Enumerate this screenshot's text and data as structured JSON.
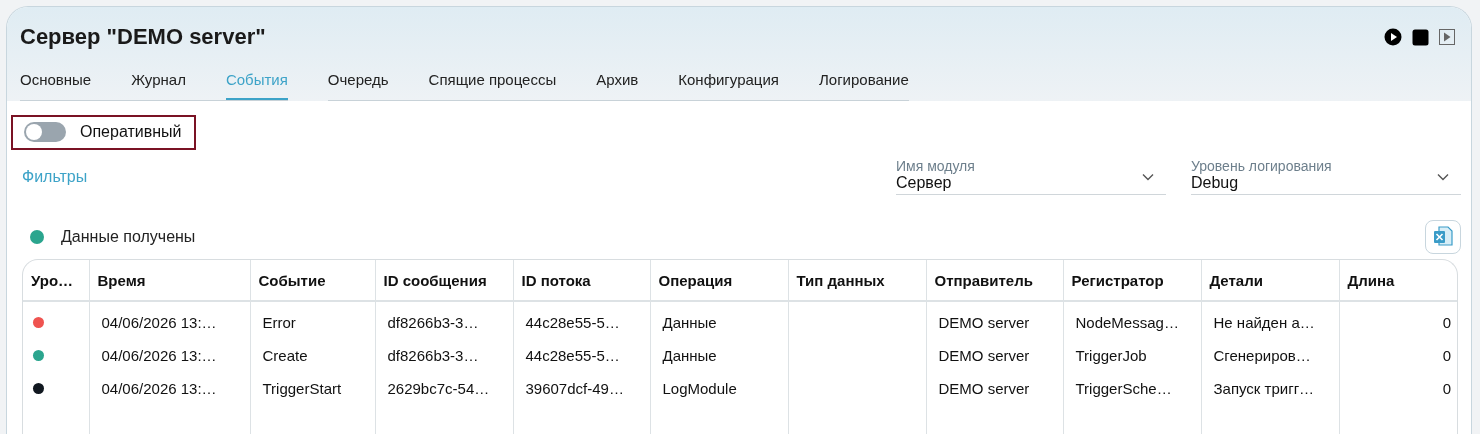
{
  "window": {
    "title": "Сервер \"DEMO server\""
  },
  "tabs": [
    {
      "label": "Основные",
      "selected": false
    },
    {
      "label": "Журнал",
      "selected": false
    },
    {
      "label": "События",
      "selected": true
    },
    {
      "label": "Очередь",
      "selected": false
    },
    {
      "label": "Спящие процессы",
      "selected": false
    },
    {
      "label": "Архив",
      "selected": false
    },
    {
      "label": "Конфигурация",
      "selected": false
    },
    {
      "label": "Логирование",
      "selected": false
    }
  ],
  "live_toggle": {
    "label": "Оперативный",
    "on": false
  },
  "filters_link": "Фильтры",
  "selects": [
    {
      "label": "Имя модуля",
      "value": "Сервер"
    },
    {
      "label": "Уровень логирования",
      "value": "Debug"
    }
  ],
  "status": {
    "text": "Данные получены",
    "color": "#2ba58e"
  },
  "table": {
    "columns": [
      "Уро…",
      "Время",
      "Событие",
      "ID сообщения",
      "ID потока",
      "Операция",
      "Тип данных",
      "Отправитель",
      "Регистратор",
      "Детали",
      "Длина"
    ],
    "rows": [
      {
        "color": "#ef5350",
        "cells": [
          "",
          "04/06/2026 13:…",
          "Error",
          "df8266b3-3…",
          "44c28e55-5…",
          "Данные",
          "",
          "DEMO server",
          "NodeMessag…",
          "Не найден а…",
          "0"
        ]
      },
      {
        "color": "#2ba58e",
        "cells": [
          "",
          "04/06/2026 13:…",
          "Create",
          "df8266b3-3…",
          "44c28e55-5…",
          "Данные",
          "",
          "DEMO server",
          "TriggerJob",
          "Сгенериров…",
          "0"
        ]
      },
      {
        "color": "#111820",
        "cells": [
          "",
          "04/06/2026 13:…",
          "TriggerStart",
          "2629bc7c-54…",
          "39607dcf-49…",
          "LogModule",
          "",
          "DEMO server",
          "TriggerSche…",
          "Запуск тригг…",
          "0"
        ]
      }
    ]
  }
}
